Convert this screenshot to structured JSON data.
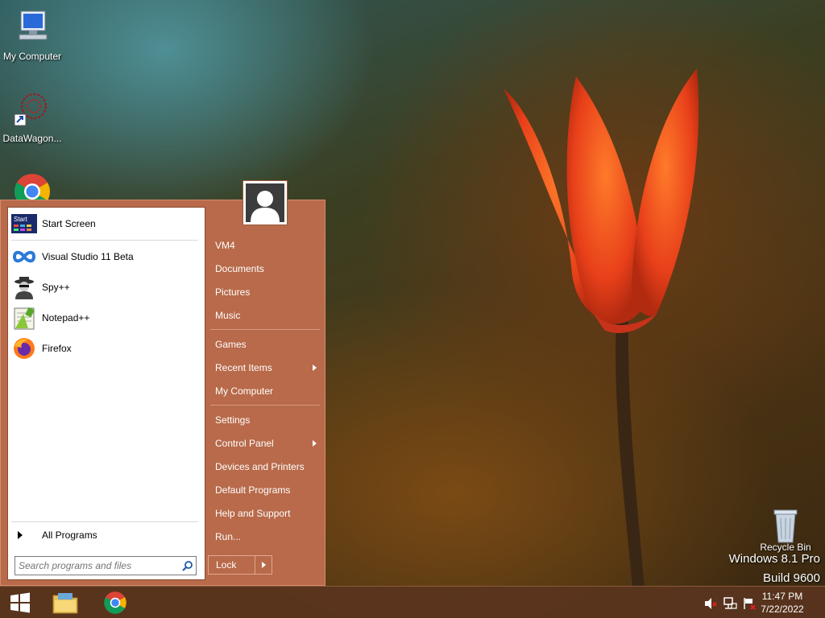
{
  "desktop": {
    "icons": [
      {
        "label": "My Computer",
        "icon": "computer-icon"
      },
      {
        "label": "DataWagon...",
        "icon": "datawagon-shortcut-icon"
      },
      {
        "label": "Google Chrome",
        "icon": "chrome-icon"
      },
      {
        "label": "Recycle Bin",
        "icon": "recycle-bin-icon"
      }
    ],
    "watermark": {
      "line1": "Windows 8.1 Pro",
      "line2": "Build 9600"
    }
  },
  "start_menu": {
    "programs": [
      {
        "label": "Start Screen",
        "icon": "start-screen-icon"
      },
      {
        "label": "Visual Studio 11 Beta",
        "icon": "visual-studio-icon"
      },
      {
        "label": "Spy++",
        "icon": "spy-icon"
      },
      {
        "label": "Notepad++",
        "icon": "notepad-plus-plus-icon"
      },
      {
        "label": "Firefox",
        "icon": "firefox-icon"
      }
    ],
    "start_screen_icon_text": "Start",
    "all_programs": "All Programs",
    "search": {
      "placeholder": "Search programs and files",
      "value": ""
    },
    "right_items": {
      "user": "VM4",
      "documents": "Documents",
      "pictures": "Pictures",
      "music": "Music",
      "games": "Games",
      "recent_items": "Recent Items",
      "my_computer": "My Computer",
      "settings": "Settings",
      "control_panel": "Control Panel",
      "devices_printers": "Devices and Printers",
      "default_programs": "Default Programs",
      "help_support": "Help and Support",
      "run": "Run..."
    },
    "lock": "Lock"
  },
  "taskbar": {
    "time": "11:47 PM",
    "date": "7/22/2022"
  },
  "colors": {
    "menu_bg": "#b86a4a",
    "taskbar_bg": "#5a341e"
  }
}
